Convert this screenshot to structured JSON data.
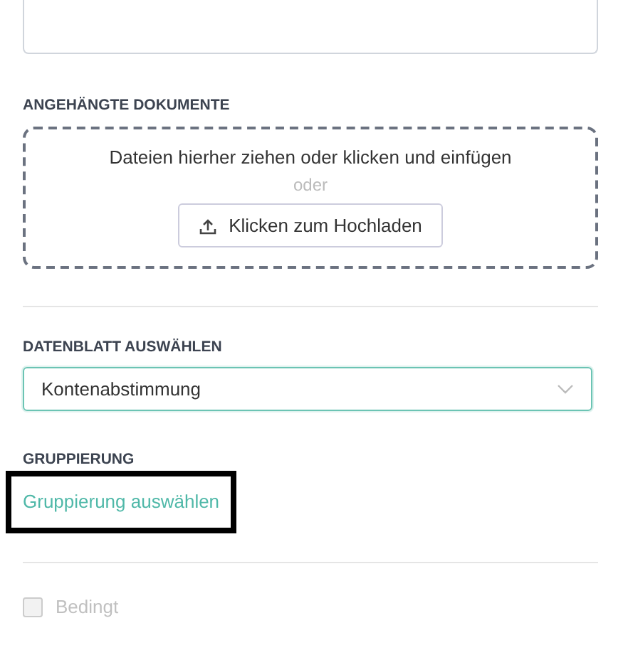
{
  "attachments": {
    "label": "ANGEHÄNGTE DOKUMENTE",
    "drop_hint": "Dateien hierher ziehen oder klicken und einfügen",
    "or": "oder",
    "upload_button": "Klicken zum Hochladen"
  },
  "datasheet": {
    "label": "DATENBLATT AUSWÄHLEN",
    "value": "Kontenabstimmung",
    "focused": true
  },
  "grouping": {
    "label": "GRUPPIERUNG",
    "link": "Gruppierung auswählen",
    "highlighted": true
  },
  "conditional": {
    "label": "Bedingt",
    "checked": false,
    "disabled": true
  }
}
